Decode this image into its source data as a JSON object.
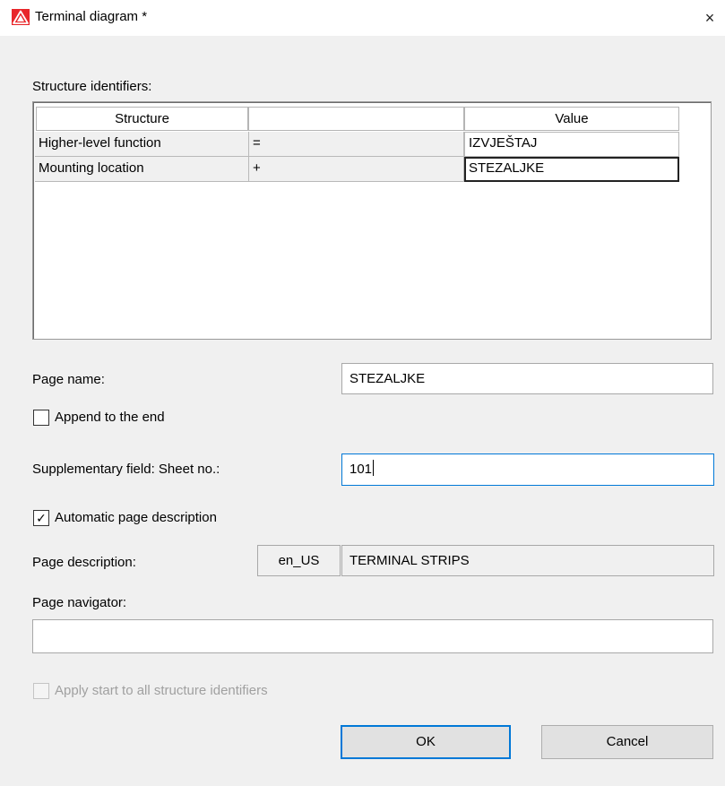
{
  "window": {
    "title": "Terminal diagram *",
    "close_glyph": "×",
    "app_icon": "warning-triangle-icon",
    "accent_color": "#0078d7",
    "icon_color": "#e8262a"
  },
  "structure_identifiers": {
    "label": "Structure identifiers:",
    "columns": [
      "Structure",
      "",
      "Value"
    ],
    "rows": [
      {
        "structure": "Higher-level function",
        "prefix": "=",
        "value": "IZVJEŠTAJ"
      },
      {
        "structure": "Mounting location",
        "prefix": "+",
        "value": "STEZALJKE"
      }
    ]
  },
  "page_name": {
    "label": "Page name:",
    "value": "STEZALJKE"
  },
  "append_to_end": {
    "label": "Append to the end",
    "checked": false
  },
  "sheet_no": {
    "label": "Supplementary field: Sheet no.:",
    "value": "101"
  },
  "auto_description": {
    "label": "Automatic page description",
    "checked": true,
    "check_glyph": "✓"
  },
  "page_description": {
    "label": "Page description:",
    "language": "en_US",
    "value": "TERMINAL STRIPS"
  },
  "page_navigator": {
    "label": "Page navigator:",
    "value": ""
  },
  "apply_start": {
    "label": "Apply start to all structure identifiers",
    "checked": false,
    "enabled": false
  },
  "buttons": {
    "ok": "OK",
    "cancel": "Cancel"
  }
}
